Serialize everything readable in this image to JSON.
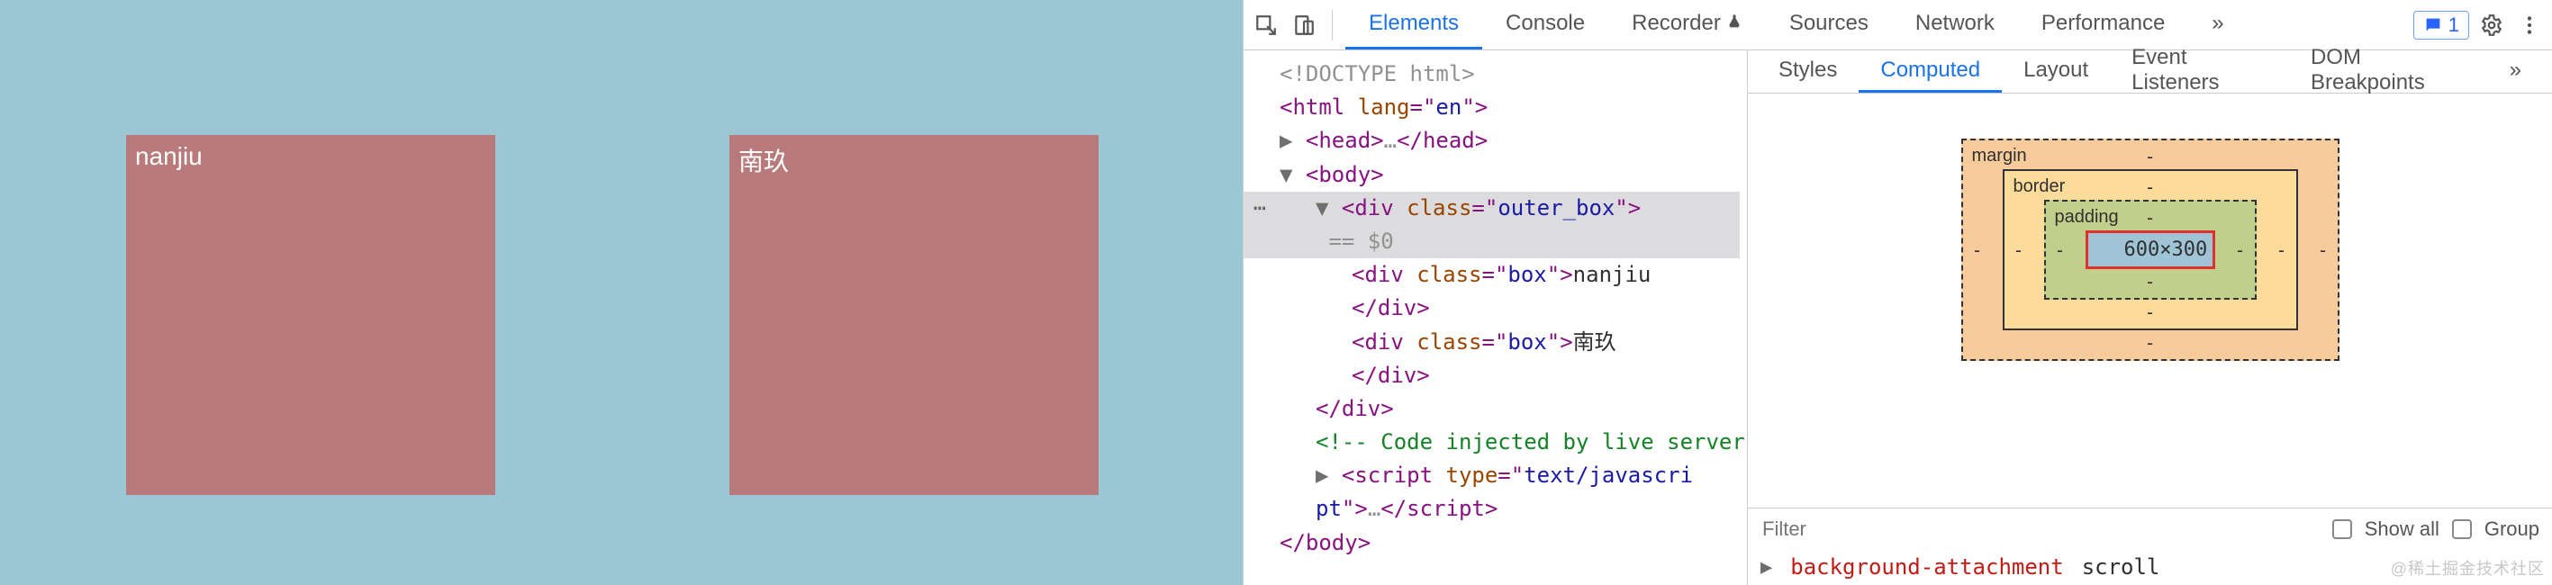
{
  "page": {
    "box1_text": "nanjiu",
    "box2_text": "南玖"
  },
  "devtools": {
    "main_tabs": [
      "Elements",
      "Console",
      "Recorder",
      "Sources",
      "Network",
      "Performance"
    ],
    "main_active_index": 0,
    "issues_count": "1",
    "side_tabs": [
      "Styles",
      "Computed",
      "Layout",
      "Event Listeners",
      "DOM Breakpoints"
    ],
    "side_active_index": 1,
    "filter_placeholder": "Filter",
    "show_all_label": "Show all",
    "group_label": "Group",
    "box_model": {
      "margin": "margin",
      "border": "border",
      "padding": "padding",
      "content": "600×300",
      "dash": "-"
    },
    "style_prop": "background-attachment",
    "style_val": "scroll",
    "dom": {
      "doctype": "<!DOCTYPE html>",
      "html_open": "<html lang=\"en\">",
      "head": "<head>…</head>",
      "body_open": "<body>",
      "outer_open": "<div class=\"outer_box\">",
      "sel_suffix": " == $0",
      "box1_open": "<div class=\"box\">nanjiu",
      "div_close": "</div>",
      "box2_open": "<div class=\"box\">南玖",
      "comment": "<!-- Code injected by live server -->",
      "script_open": "<script type=\"text/javascript\">…</scr",
      "script_close_frag": "ipt>",
      "body_close": "</body>"
    }
  },
  "watermark": "@稀土掘金技术社区"
}
